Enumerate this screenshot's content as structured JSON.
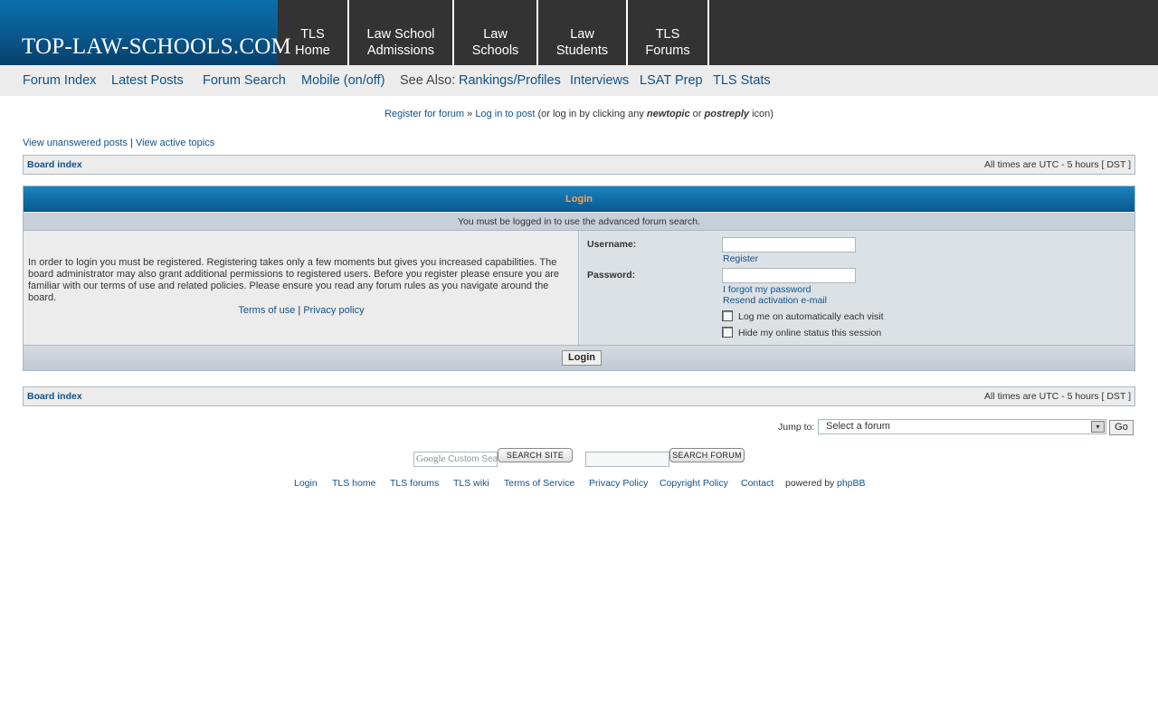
{
  "header": {
    "logo_text": "TOP-LAW-SCHOOLS.COM",
    "tabs": [
      {
        "label": "TLS\nHome"
      },
      {
        "label": "Law School\nAdmissions"
      },
      {
        "label": "Law\nSchools"
      },
      {
        "label": "Law\nStudents"
      },
      {
        "label": "TLS\nForums"
      }
    ]
  },
  "subnav": {
    "forum_index": "Forum Index",
    "latest_posts": "Latest Posts",
    "forum_search": "Forum Search",
    "mobile": "Mobile (on/off)",
    "see_also": "See Also:",
    "rankings": "Rankings/Profiles",
    "interviews": "Interviews",
    "lsat_prep": "LSAT Prep",
    "tls_stats": "TLS Stats"
  },
  "notice": {
    "register": "Register for forum",
    "sep": "»",
    "login": "Log in to post",
    "rest_1": "(or log in by clicking any",
    "newtopic": "newtopic",
    "or": "or",
    "postreply": "postreply",
    "rest_2": "icon)"
  },
  "quicklinks": {
    "unanswered": "View unanswered posts",
    "sep": "|",
    "active": "View active topics"
  },
  "breadcrumb": {
    "board_index": "Board index",
    "timezone": "All times are UTC - 5 hours [ DST ]"
  },
  "login_panel": {
    "title": "Login",
    "subtitle": "You must be logged in to use the advanced forum search.",
    "info": "In order to login you must be registered. Registering takes only a few moments but gives you increased capabilities. The board administrator may also grant additional permissions to registered users. Before you register please ensure you are familiar with our terms of use and related policies. Please ensure you read any forum rules as you navigate around the board.",
    "terms": "Terms of use",
    "sep": "|",
    "privacy": "Privacy policy",
    "username_label": "Username:",
    "username_value": "",
    "register_link": "Register",
    "password_label": "Password:",
    "password_value": "",
    "forgot_link": "I forgot my password",
    "resend_link": "Resend activation e-mail",
    "autologin_label": "Log me on automatically each visit",
    "hide_label": "Hide my online status this session",
    "login_button": "Login"
  },
  "jump": {
    "label": "Jump to:",
    "selected": "Select a forum",
    "go": "Go"
  },
  "search": {
    "google_brand": "Google",
    "google_placeholder": "Custom Search",
    "site_button": "SEARCH SITE",
    "forum_button": "SEARCH FORUM",
    "forum_input_value": ""
  },
  "footer": {
    "links": [
      "Login",
      "TLS home",
      "TLS forums",
      "TLS wiki",
      "Terms of Service",
      "Privacy Policy",
      "Copyright Policy",
      "Contact"
    ],
    "powered": "powered by",
    "phpbb": "phpBB"
  },
  "colors": {
    "link": "#105289",
    "header_bg": "#333333",
    "panel_header": "#0f6aa3",
    "panel_title": "#ffa34f"
  }
}
